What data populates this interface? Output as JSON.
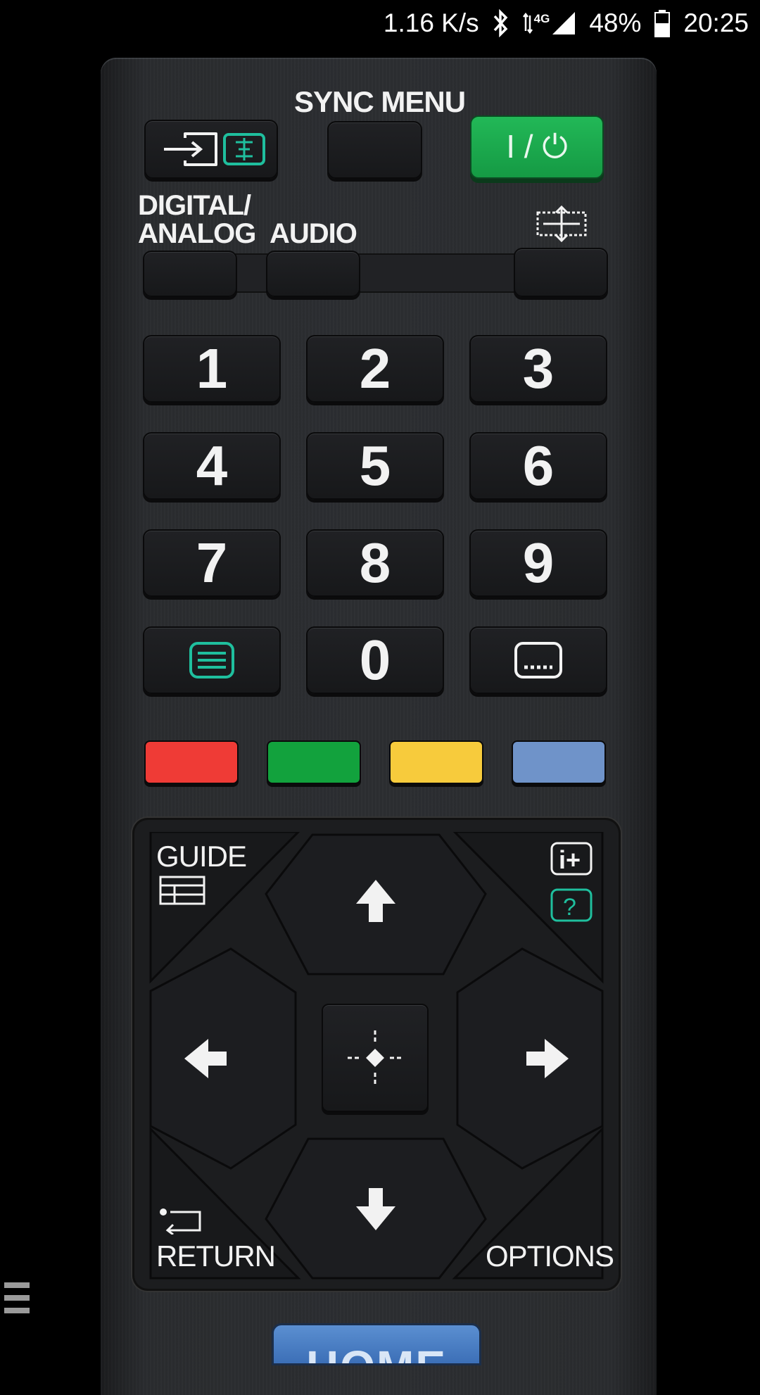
{
  "status_bar": {
    "network_speed": "1.16 K/s",
    "network_type": "4G",
    "battery": "48%",
    "time": "20:25"
  },
  "remote": {
    "sync_menu_label": "SYNC MENU",
    "digital_analog_label_line1": "DIGITAL/",
    "digital_analog_label_line2": "ANALOG",
    "audio_label": "AUDIO",
    "power_label": "I / ⏻",
    "numbers": [
      "1",
      "2",
      "3",
      "4",
      "5",
      "6",
      "7",
      "8",
      "9",
      "0"
    ],
    "guide_label": "GUIDE",
    "return_label": "RETURN",
    "options_label": "OPTIONS",
    "home_label": "HOME",
    "colors": {
      "red": "#ef3b36",
      "green": "#12a23d",
      "yellow": "#f7cb3c",
      "blue": "#6f93c9",
      "power": "#1aa64a",
      "teal_icon": "#1fbf9e"
    }
  }
}
